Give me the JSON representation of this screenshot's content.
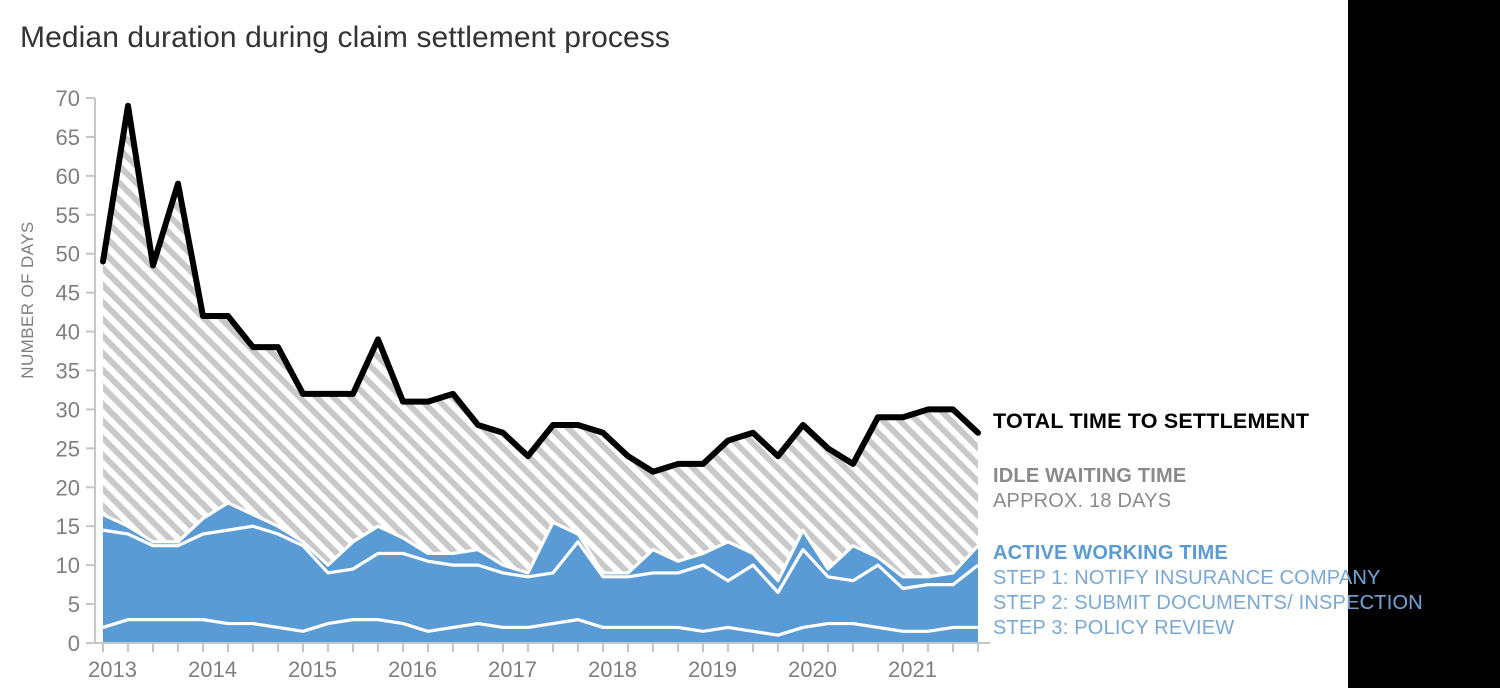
{
  "chart_title": "Median duration during claim settlement process",
  "axes": {
    "ylabel": "NUMBER OF DAYS",
    "yticks": [
      0,
      5,
      10,
      15,
      20,
      25,
      30,
      35,
      40,
      45,
      50,
      55,
      60,
      65,
      70
    ],
    "xticks": [
      "2013",
      "2014",
      "2015",
      "2016",
      "2017",
      "2018",
      "2019",
      "2020",
      "2021"
    ]
  },
  "legend": {
    "total_label": "TOTAL TIME TO SETTLEMENT",
    "idle_label": "IDLE WAITING TIME",
    "idle_sub": "APPROX. 18 DAYS",
    "active_label": "ACTIVE WORKING TIME",
    "step1": "STEP 1: NOTIFY INSURANCE COMPANY",
    "step2": "STEP 2: SUBMIT DOCUMENTS/  INSPECTION",
    "step3": "STEP 3: POLICY REVIEW"
  },
  "colors": {
    "blue": "#5b9bd5",
    "total_line": "#000000",
    "hatch": "#bfbfbf",
    "axis": "#bfbfbf",
    "tick_text": "#7f7f7f",
    "title_text": "#333333",
    "idle_text": "#8a8a8a",
    "step_text": "#7ba7d4",
    "panel": "#000000"
  },
  "chart_data": {
    "type": "area",
    "title": "Median duration during claim settlement process",
    "xlabel": "",
    "ylabel": "NUMBER OF DAYS",
    "ylim": [
      0,
      70
    ],
    "grid": false,
    "legend_position": "right",
    "x": [
      "2013 Q1",
      "2013 Q2",
      "2013 Q3",
      "2013 Q4",
      "2014 Q1",
      "2014 Q2",
      "2014 Q3",
      "2014 Q4",
      "2015 Q1",
      "2015 Q2",
      "2015 Q3",
      "2015 Q4",
      "2016 Q1",
      "2016 Q2",
      "2016 Q3",
      "2016 Q4",
      "2017 Q1",
      "2017 Q2",
      "2017 Q3",
      "2017 Q4",
      "2018 Q1",
      "2018 Q2",
      "2018 Q3",
      "2018 Q4",
      "2019 Q1",
      "2019 Q2",
      "2019 Q3",
      "2019 Q4",
      "2020 Q1",
      "2020 Q2",
      "2020 Q3",
      "2020 Q4",
      "2021 Q1",
      "2021 Q2",
      "2021 Q3",
      "2021 Q4"
    ],
    "series": [
      {
        "name": "STEP 1: NOTIFY INSURANCE COMPANY",
        "stack": "active",
        "color": "#5b9bd5",
        "values": [
          2.0,
          3.0,
          3.0,
          3.0,
          3.0,
          2.5,
          2.5,
          2.0,
          1.5,
          2.5,
          3.0,
          3.0,
          2.5,
          1.5,
          2.0,
          2.5,
          2.0,
          2.0,
          2.5,
          3.0,
          2.0,
          2.0,
          2.0,
          2.0,
          1.5,
          2.0,
          1.5,
          1.0,
          2.0,
          2.5,
          2.5,
          2.0,
          1.5,
          1.5,
          2.0,
          2.0
        ]
      },
      {
        "name": "STEP 2: SUBMIT DOCUMENTS/  INSPECTION",
        "stack": "active",
        "color": "#5b9bd5",
        "values": [
          12.5,
          11.0,
          9.5,
          9.5,
          11.0,
          12.0,
          12.5,
          12.0,
          11.0,
          6.5,
          6.5,
          8.5,
          9.0,
          9.0,
          8.0,
          7.5,
          7.0,
          6.5,
          6.5,
          10.0,
          6.5,
          6.5,
          7.0,
          7.0,
          8.5,
          6.0,
          8.5,
          5.5,
          10.0,
          6.0,
          5.5,
          8.0,
          5.5,
          6.0,
          5.5,
          8.0
        ]
      },
      {
        "name": "STEP 3: POLICY REVIEW",
        "stack": "active",
        "color": "#5b9bd5",
        "values": [
          2.0,
          1.0,
          0.5,
          0.5,
          2.0,
          3.5,
          1.5,
          1.0,
          0.5,
          1.0,
          3.5,
          3.5,
          2.0,
          1.0,
          1.5,
          2.0,
          1.0,
          0.5,
          6.5,
          1.0,
          0.5,
          0.5,
          3.0,
          1.5,
          1.5,
          5.0,
          1.5,
          1.5,
          2.5,
          1.0,
          4.5,
          1.0,
          1.5,
          1.0,
          1.5,
          2.5
        ]
      },
      {
        "name": "IDLE WAITING TIME",
        "stack": "idle",
        "color": "#bfbfbf",
        "pattern": "diagonal-hatch",
        "values": [
          32.5,
          54.0,
          35.5,
          46.0,
          26.0,
          24.0,
          21.5,
          23.0,
          19.0,
          22.0,
          19.0,
          24.0,
          17.5,
          19.5,
          16.5,
          15.0,
          14.0,
          15.0,
          12.5,
          14.0,
          13.0,
          13.0,
          11.0,
          12.5,
          12.5,
          13.0,
          15.5,
          16.0,
          13.5,
          15.5,
          10.5,
          18.0,
          20.5,
          21.5,
          21.0,
          14.5
        ]
      }
    ],
    "total_line": {
      "name": "TOTAL TIME TO SETTLEMENT",
      "color": "#000000",
      "values": [
        49,
        69,
        48.5,
        59,
        42,
        42,
        38,
        38,
        32,
        32,
        32,
        39,
        31,
        31,
        32,
        28,
        27,
        24,
        28,
        28,
        27,
        24,
        22,
        23,
        23,
        26,
        27,
        24,
        28,
        25,
        23,
        29,
        29,
        30,
        30,
        27
      ]
    },
    "annotations": [
      {
        "text": "APPROX. 18 DAYS",
        "refers_to": "IDLE WAITING TIME"
      }
    ]
  }
}
